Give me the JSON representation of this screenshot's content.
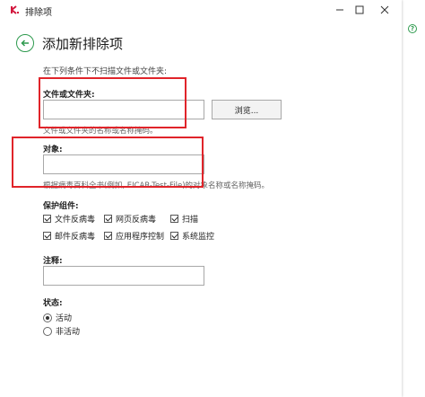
{
  "window": {
    "title": "排除项"
  },
  "page": {
    "heading": "添加新排除项",
    "description": "在下列条件下不扫描文件或文件夹:"
  },
  "file_section": {
    "label": "文件或文件夹:",
    "value": "",
    "browse_label": "浏览...",
    "hint": "文件或文件夹的名称或名称掩码。"
  },
  "object_section": {
    "label": "对象:",
    "value": "",
    "hint": "根据病毒百科全书(例如, EICAR-Test-File)的对象名称或名称掩码。"
  },
  "protection": {
    "label": "保护组件:",
    "components": [
      "文件反病毒",
      "网页反病毒",
      "扫描",
      "邮件反病毒",
      "应用程序控制",
      "系统监控"
    ]
  },
  "comment": {
    "label": "注释:",
    "value": ""
  },
  "status": {
    "label": "状态:",
    "options": [
      "活动",
      "非活动"
    ],
    "selected": "活动"
  },
  "colors": {
    "accent": "#2e9a4e",
    "highlight": "#e0242a",
    "logo": "#d3163e"
  }
}
